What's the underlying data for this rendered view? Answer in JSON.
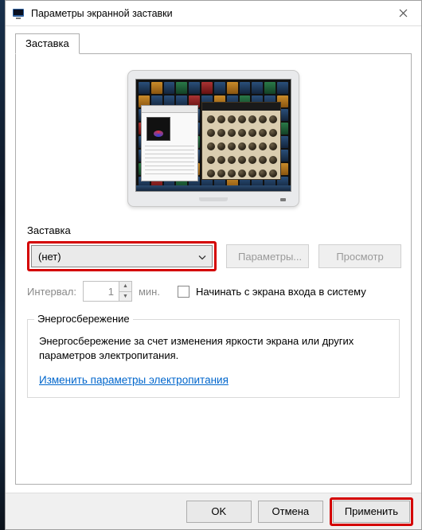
{
  "window": {
    "title": "Параметры экранной заставки"
  },
  "tabs": {
    "main": "Заставка"
  },
  "section": {
    "label": "Заставка",
    "select_value": "(нет)",
    "params_btn": "Параметры...",
    "preview_btn": "Просмотр",
    "interval_label": "Интервал:",
    "interval_value": "1",
    "interval_unit": "мин.",
    "resume_checkbox": "Начинать с экрана входа в систему"
  },
  "power": {
    "legend": "Энергосбережение",
    "text": "Энергосбережение за счет изменения яркости экрана или других параметров электропитания.",
    "link": "Изменить параметры электропитания"
  },
  "footer": {
    "ok": "OK",
    "cancel": "Отмена",
    "apply": "Применить"
  }
}
